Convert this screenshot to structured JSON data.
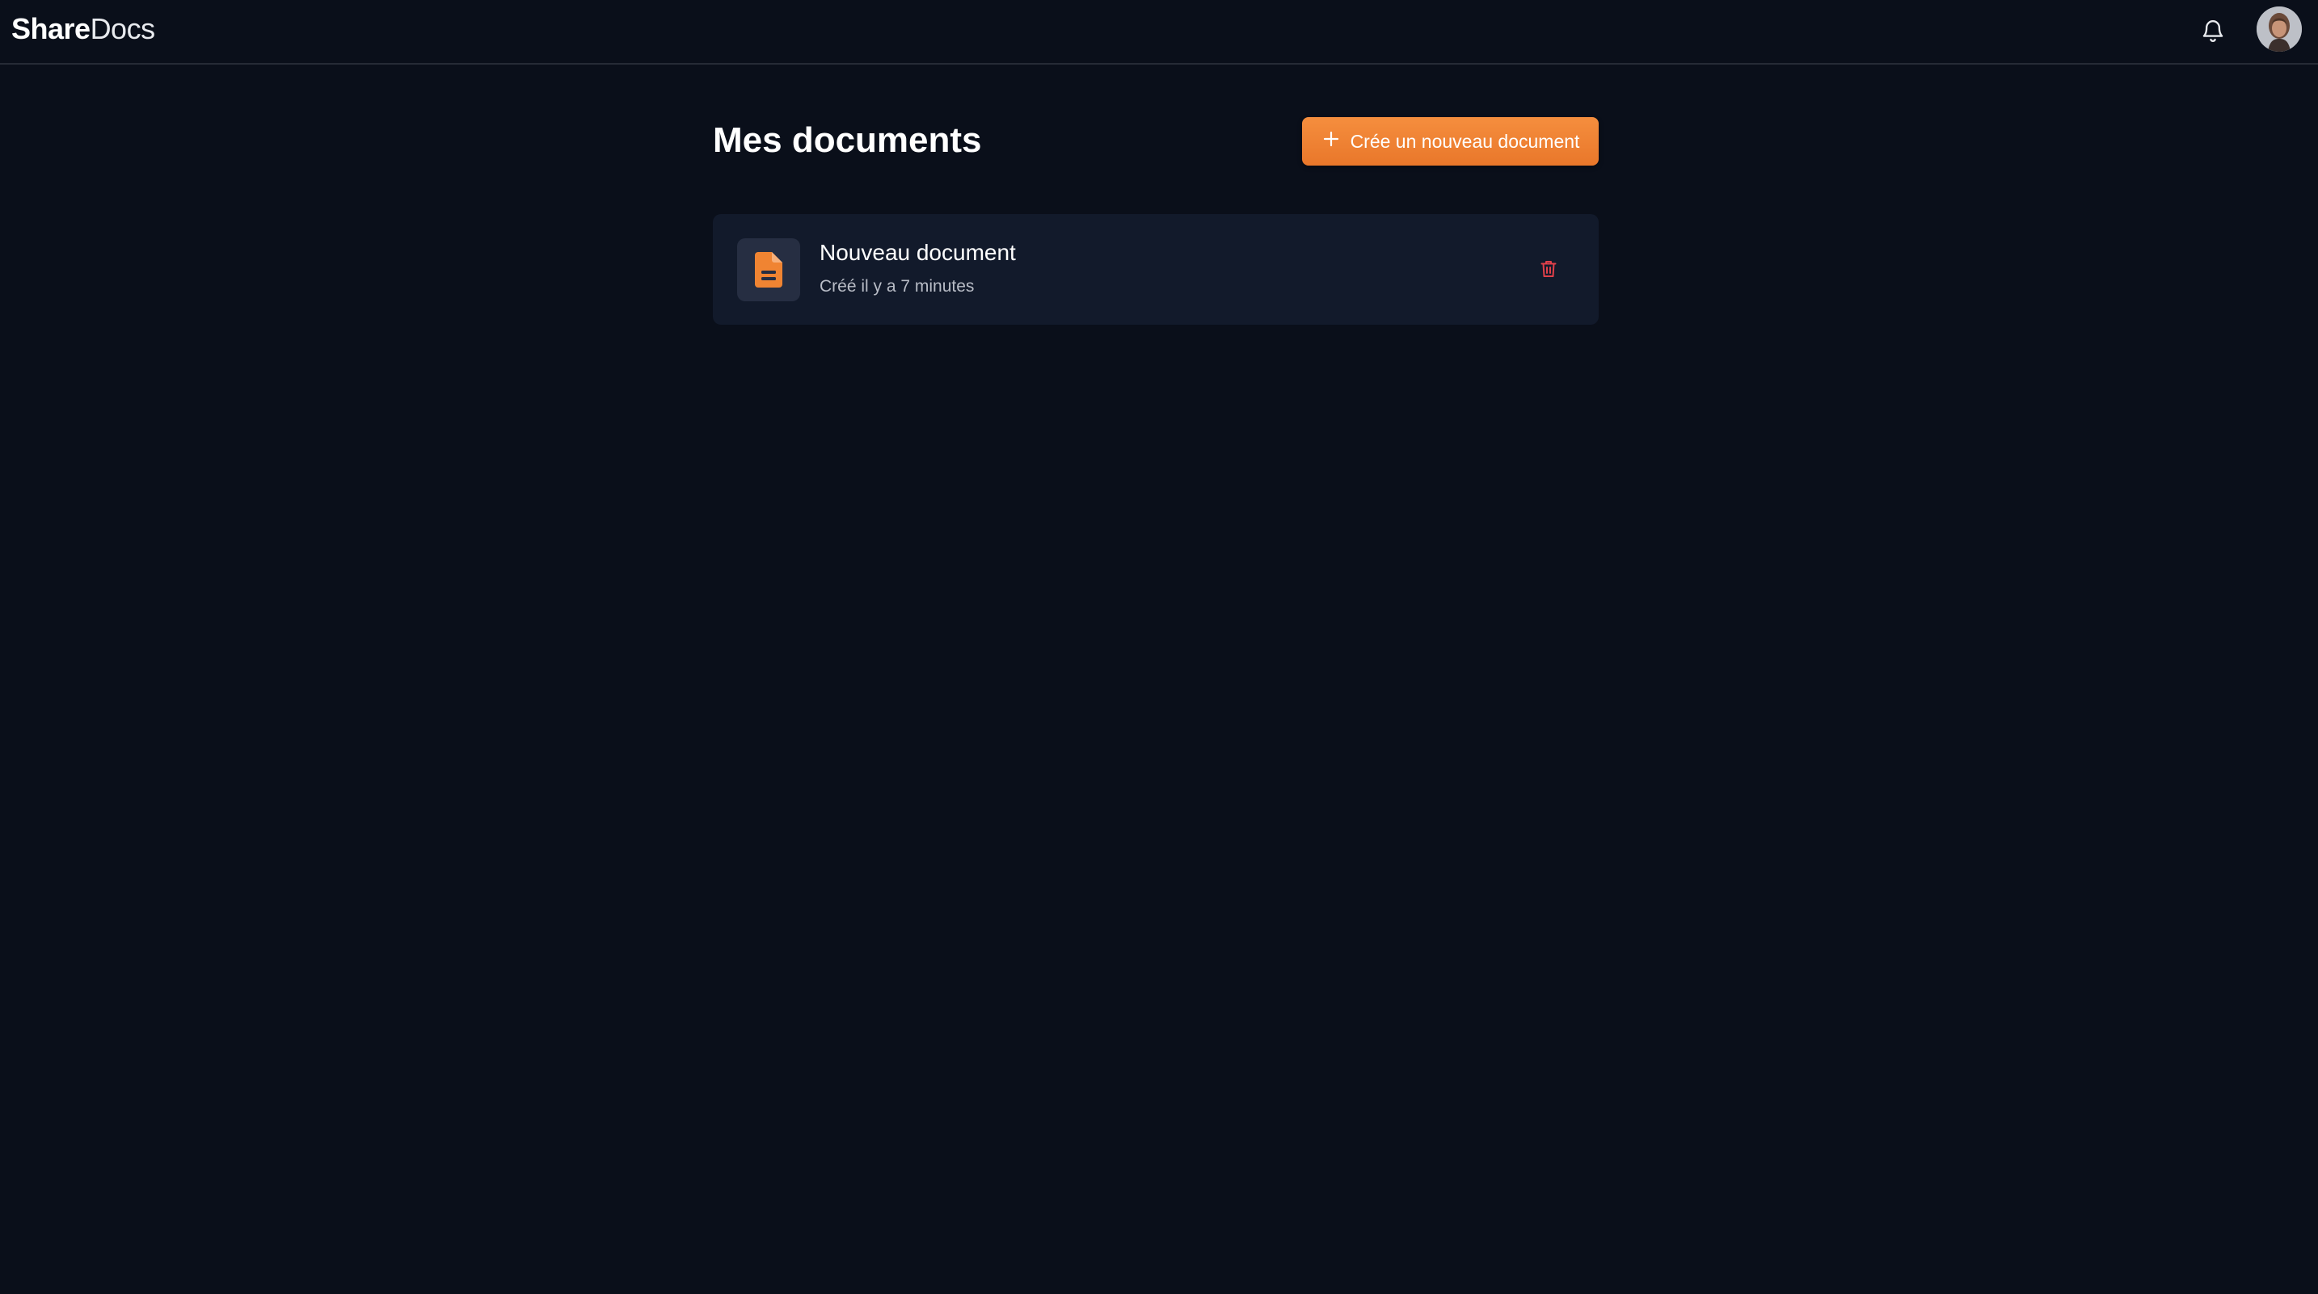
{
  "header": {
    "logo_bold": "Share",
    "logo_light": "Docs",
    "icons": {
      "notifications": "bell-icon",
      "avatar": "user-avatar"
    }
  },
  "main": {
    "title": "Mes documents",
    "new_button_label": "Crée un nouveau document",
    "new_button_icon": "plus-icon",
    "documents": [
      {
        "title": "Nouveau document",
        "subtitle": "Créé il y a 7 minutes",
        "icon": "document-icon",
        "action_icon": "trash-icon"
      }
    ]
  },
  "colors": {
    "background": "#0a0f1a",
    "card": "#121a2b",
    "accent": "#f08432",
    "danger": "#e0404a"
  }
}
